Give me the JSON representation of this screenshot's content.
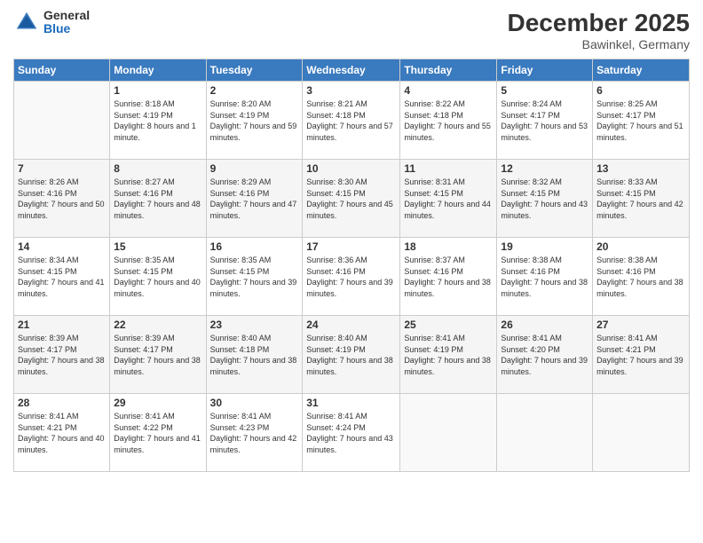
{
  "header": {
    "logo": {
      "general": "General",
      "blue": "Blue"
    },
    "title": "December 2025",
    "subtitle": "Bawinkel, Germany"
  },
  "weekdays": [
    "Sunday",
    "Monday",
    "Tuesday",
    "Wednesday",
    "Thursday",
    "Friday",
    "Saturday"
  ],
  "weeks": [
    [
      {
        "day": "",
        "sunrise": "",
        "sunset": "",
        "daylight": ""
      },
      {
        "day": "1",
        "sunrise": "Sunrise: 8:18 AM",
        "sunset": "Sunset: 4:19 PM",
        "daylight": "Daylight: 8 hours and 1 minute."
      },
      {
        "day": "2",
        "sunrise": "Sunrise: 8:20 AM",
        "sunset": "Sunset: 4:19 PM",
        "daylight": "Daylight: 7 hours and 59 minutes."
      },
      {
        "day": "3",
        "sunrise": "Sunrise: 8:21 AM",
        "sunset": "Sunset: 4:18 PM",
        "daylight": "Daylight: 7 hours and 57 minutes."
      },
      {
        "day": "4",
        "sunrise": "Sunrise: 8:22 AM",
        "sunset": "Sunset: 4:18 PM",
        "daylight": "Daylight: 7 hours and 55 minutes."
      },
      {
        "day": "5",
        "sunrise": "Sunrise: 8:24 AM",
        "sunset": "Sunset: 4:17 PM",
        "daylight": "Daylight: 7 hours and 53 minutes."
      },
      {
        "day": "6",
        "sunrise": "Sunrise: 8:25 AM",
        "sunset": "Sunset: 4:17 PM",
        "daylight": "Daylight: 7 hours and 51 minutes."
      }
    ],
    [
      {
        "day": "7",
        "sunrise": "Sunrise: 8:26 AM",
        "sunset": "Sunset: 4:16 PM",
        "daylight": "Daylight: 7 hours and 50 minutes."
      },
      {
        "day": "8",
        "sunrise": "Sunrise: 8:27 AM",
        "sunset": "Sunset: 4:16 PM",
        "daylight": "Daylight: 7 hours and 48 minutes."
      },
      {
        "day": "9",
        "sunrise": "Sunrise: 8:29 AM",
        "sunset": "Sunset: 4:16 PM",
        "daylight": "Daylight: 7 hours and 47 minutes."
      },
      {
        "day": "10",
        "sunrise": "Sunrise: 8:30 AM",
        "sunset": "Sunset: 4:15 PM",
        "daylight": "Daylight: 7 hours and 45 minutes."
      },
      {
        "day": "11",
        "sunrise": "Sunrise: 8:31 AM",
        "sunset": "Sunset: 4:15 PM",
        "daylight": "Daylight: 7 hours and 44 minutes."
      },
      {
        "day": "12",
        "sunrise": "Sunrise: 8:32 AM",
        "sunset": "Sunset: 4:15 PM",
        "daylight": "Daylight: 7 hours and 43 minutes."
      },
      {
        "day": "13",
        "sunrise": "Sunrise: 8:33 AM",
        "sunset": "Sunset: 4:15 PM",
        "daylight": "Daylight: 7 hours and 42 minutes."
      }
    ],
    [
      {
        "day": "14",
        "sunrise": "Sunrise: 8:34 AM",
        "sunset": "Sunset: 4:15 PM",
        "daylight": "Daylight: 7 hours and 41 minutes."
      },
      {
        "day": "15",
        "sunrise": "Sunrise: 8:35 AM",
        "sunset": "Sunset: 4:15 PM",
        "daylight": "Daylight: 7 hours and 40 minutes."
      },
      {
        "day": "16",
        "sunrise": "Sunrise: 8:35 AM",
        "sunset": "Sunset: 4:15 PM",
        "daylight": "Daylight: 7 hours and 39 minutes."
      },
      {
        "day": "17",
        "sunrise": "Sunrise: 8:36 AM",
        "sunset": "Sunset: 4:16 PM",
        "daylight": "Daylight: 7 hours and 39 minutes."
      },
      {
        "day": "18",
        "sunrise": "Sunrise: 8:37 AM",
        "sunset": "Sunset: 4:16 PM",
        "daylight": "Daylight: 7 hours and 38 minutes."
      },
      {
        "day": "19",
        "sunrise": "Sunrise: 8:38 AM",
        "sunset": "Sunset: 4:16 PM",
        "daylight": "Daylight: 7 hours and 38 minutes."
      },
      {
        "day": "20",
        "sunrise": "Sunrise: 8:38 AM",
        "sunset": "Sunset: 4:16 PM",
        "daylight": "Daylight: 7 hours and 38 minutes."
      }
    ],
    [
      {
        "day": "21",
        "sunrise": "Sunrise: 8:39 AM",
        "sunset": "Sunset: 4:17 PM",
        "daylight": "Daylight: 7 hours and 38 minutes."
      },
      {
        "day": "22",
        "sunrise": "Sunrise: 8:39 AM",
        "sunset": "Sunset: 4:17 PM",
        "daylight": "Daylight: 7 hours and 38 minutes."
      },
      {
        "day": "23",
        "sunrise": "Sunrise: 8:40 AM",
        "sunset": "Sunset: 4:18 PM",
        "daylight": "Daylight: 7 hours and 38 minutes."
      },
      {
        "day": "24",
        "sunrise": "Sunrise: 8:40 AM",
        "sunset": "Sunset: 4:19 PM",
        "daylight": "Daylight: 7 hours and 38 minutes."
      },
      {
        "day": "25",
        "sunrise": "Sunrise: 8:41 AM",
        "sunset": "Sunset: 4:19 PM",
        "daylight": "Daylight: 7 hours and 38 minutes."
      },
      {
        "day": "26",
        "sunrise": "Sunrise: 8:41 AM",
        "sunset": "Sunset: 4:20 PM",
        "daylight": "Daylight: 7 hours and 39 minutes."
      },
      {
        "day": "27",
        "sunrise": "Sunrise: 8:41 AM",
        "sunset": "Sunset: 4:21 PM",
        "daylight": "Daylight: 7 hours and 39 minutes."
      }
    ],
    [
      {
        "day": "28",
        "sunrise": "Sunrise: 8:41 AM",
        "sunset": "Sunset: 4:21 PM",
        "daylight": "Daylight: 7 hours and 40 minutes."
      },
      {
        "day": "29",
        "sunrise": "Sunrise: 8:41 AM",
        "sunset": "Sunset: 4:22 PM",
        "daylight": "Daylight: 7 hours and 41 minutes."
      },
      {
        "day": "30",
        "sunrise": "Sunrise: 8:41 AM",
        "sunset": "Sunset: 4:23 PM",
        "daylight": "Daylight: 7 hours and 42 minutes."
      },
      {
        "day": "31",
        "sunrise": "Sunrise: 8:41 AM",
        "sunset": "Sunset: 4:24 PM",
        "daylight": "Daylight: 7 hours and 43 minutes."
      },
      {
        "day": "",
        "sunrise": "",
        "sunset": "",
        "daylight": ""
      },
      {
        "day": "",
        "sunrise": "",
        "sunset": "",
        "daylight": ""
      },
      {
        "day": "",
        "sunrise": "",
        "sunset": "",
        "daylight": ""
      }
    ]
  ]
}
